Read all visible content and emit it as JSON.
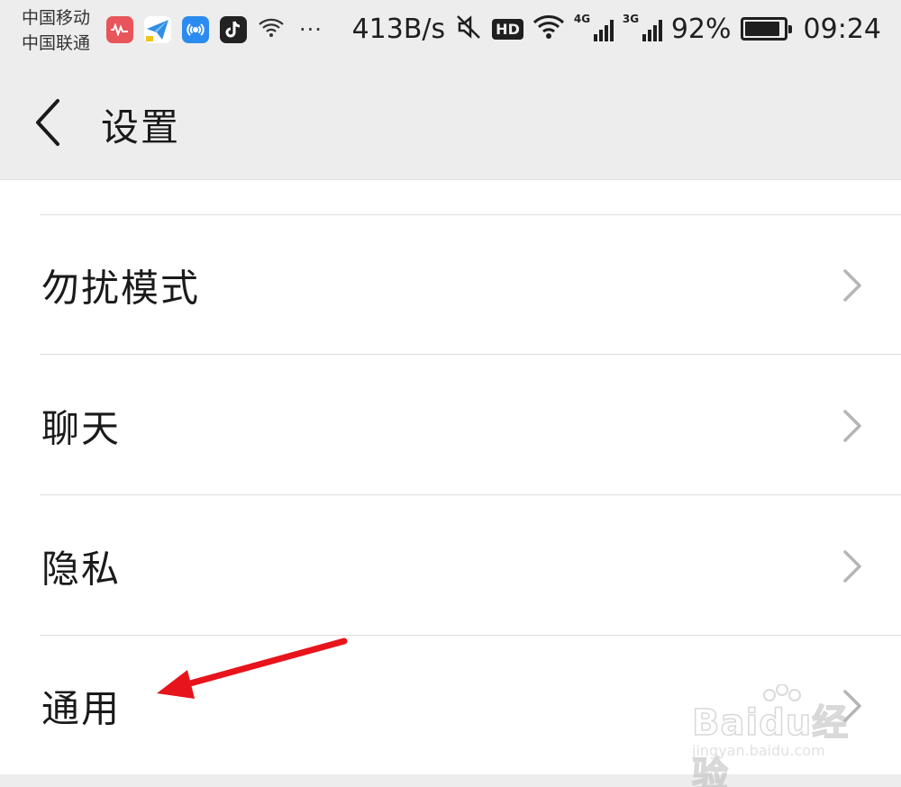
{
  "status_bar": {
    "carrier_1": "中国移动",
    "carrier_2": "中国联通",
    "notification_icons": [
      "music-app-icon",
      "paper-plane-icon",
      "wifi-key-icon",
      "tiktok-icon",
      "wifi-question-icon"
    ],
    "more": "···",
    "net_speed": "413B/s",
    "hd_badge": "HD",
    "signal_1_label": "4G",
    "signal_2_label": "3G",
    "battery_percent": "92%",
    "battery_level": 0.92,
    "time": "09:24"
  },
  "header": {
    "title": "设置"
  },
  "settings": {
    "items": [
      {
        "label": "勿扰模式"
      },
      {
        "label": "聊天"
      },
      {
        "label": "隐私"
      },
      {
        "label": "通用"
      }
    ]
  },
  "watermark": {
    "main": "Baidu经验",
    "sub": "jingyan.baidu.com"
  },
  "colors": {
    "background": "#ededed",
    "list_background": "#ffffff",
    "text": "#1a1a1a",
    "chevron": "#b5b5b5",
    "annotation_arrow": "#e8141c"
  }
}
